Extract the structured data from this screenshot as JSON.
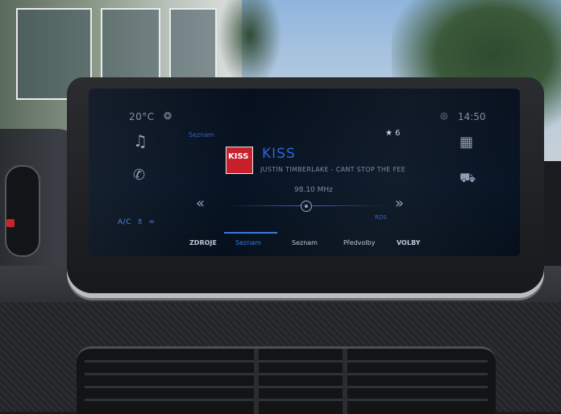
{
  "status_bar": {
    "temperature": "20°C",
    "fan_icon": "fan-icon",
    "location_icon": "location-icon",
    "clock": "14:50"
  },
  "left_rail": {
    "music_icon": "music-note-icon",
    "phone_icon": "phone-icon",
    "ac_label": "A/C  ⇯  ≈"
  },
  "right_rail": {
    "apps_icon": "grid-icon",
    "car_icon": "car-icon"
  },
  "radio": {
    "source_small": "Seznam",
    "favorite_badge": "★ 6",
    "station_logo_text": "KISS",
    "station_name": "KISS",
    "now_playing": "JUSTIN TIMBERLAKE - CANT STOP THE FEE",
    "frequency": "98.10 MHz",
    "seek_back": "«",
    "seek_forward": "»",
    "rds": "RDS"
  },
  "bottom_tabs": [
    {
      "label": "ZDROJE"
    },
    {
      "label": "Seznam",
      "active": true
    },
    {
      "label": "Seznam"
    },
    {
      "label": "Předvolby"
    },
    {
      "label": "VOLBY"
    }
  ],
  "colors": {
    "accent": "#3c78e0",
    "screen_bg": "#081424",
    "icon": "#8c9ab4"
  }
}
